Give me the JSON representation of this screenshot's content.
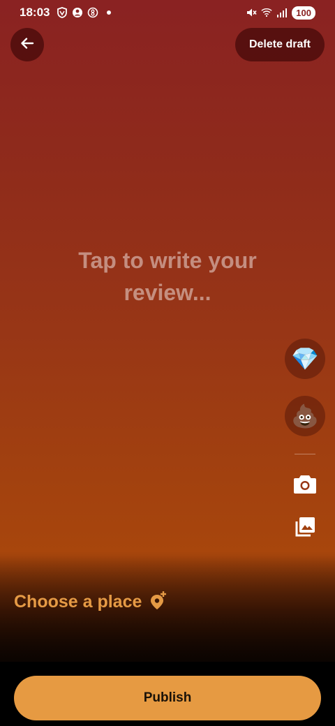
{
  "status_bar": {
    "time": "18:03",
    "battery": "100",
    "icons": [
      "shield-icon",
      "account-icon",
      "ring-icon",
      "mute-icon",
      "wifi-icon",
      "signal-icon"
    ]
  },
  "header": {
    "back_icon": "arrow-left-icon",
    "delete_label": "Delete draft"
  },
  "editor": {
    "placeholder": "Tap to write your review..."
  },
  "side_tools": {
    "rating_good": "💎",
    "rating_bad": "💩",
    "camera_icon": "camera-icon",
    "gallery_icon": "gallery-icon"
  },
  "place": {
    "label": "Choose a place",
    "icon": "add-location-icon"
  },
  "footer": {
    "publish_label": "Publish"
  },
  "colors": {
    "accent": "#e69a42",
    "place_text": "#e59a45",
    "gradient_top": "#8a2222",
    "gradient_bottom": "#a8460c"
  }
}
